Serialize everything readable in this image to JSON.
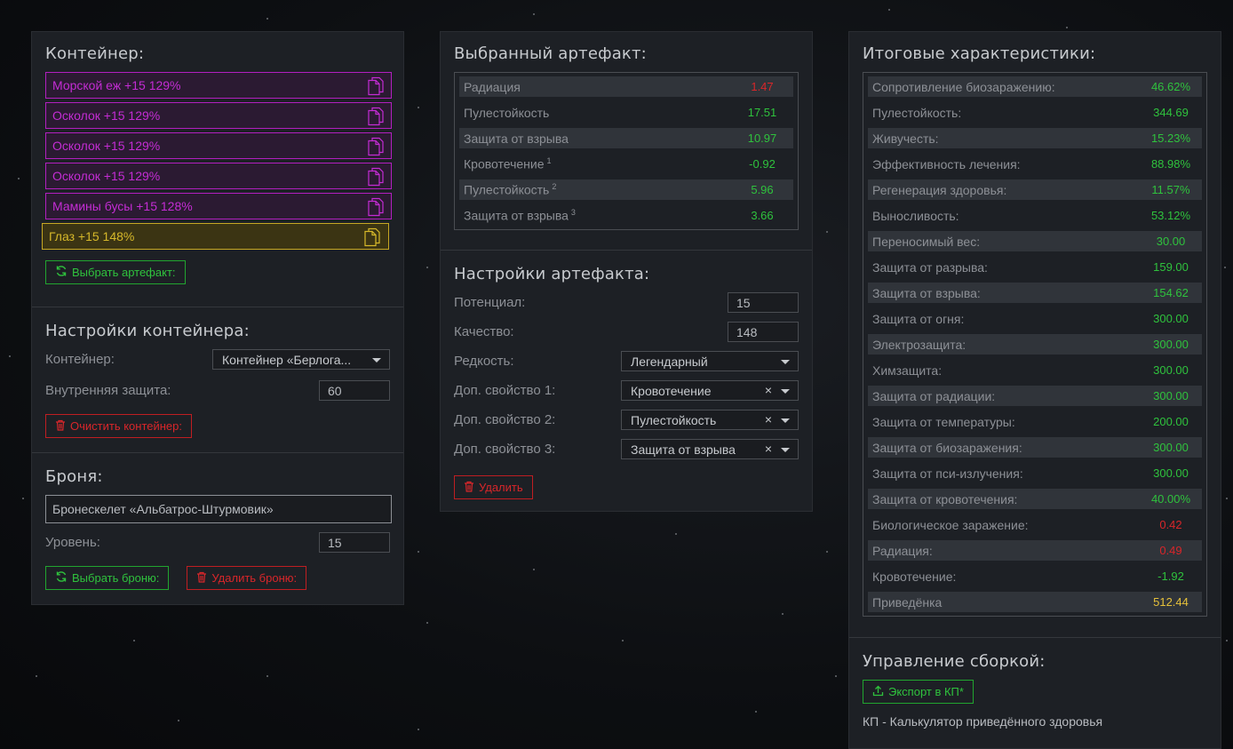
{
  "container_panel": {
    "title": "Контейнер:",
    "slots": [
      {
        "label": "Морской еж +15 129%",
        "color": "purple"
      },
      {
        "label": "Осколок +15 129%",
        "color": "purple"
      },
      {
        "label": "Осколок +15 129%",
        "color": "purple"
      },
      {
        "label": "Осколок +15 129%",
        "color": "purple"
      },
      {
        "label": "Мамины бусы +15 128%",
        "color": "purple"
      },
      {
        "label": "Глаз +15 148%",
        "color": "gold"
      }
    ],
    "select_artifact_button": "Выбрать артефакт:"
  },
  "container_settings": {
    "title": "Настройки контейнера:",
    "container_label": "Контейнер:",
    "container_value": "Контейнер «Берлога...",
    "inner_protection_label": "Внутренняя защита:",
    "inner_protection_value": "60",
    "clear_button": "Очистить контейнер:"
  },
  "armor": {
    "title": "Броня:",
    "armor_value": "Бронескелет «Альбатрос-Штурмовик»",
    "level_label": "Уровень:",
    "level_value": "15",
    "select_button": "Выбрать броню:",
    "delete_button": "Удалить броню:"
  },
  "selected_artifact": {
    "title": "Выбранный артефакт:",
    "stats": [
      {
        "name": "Радиация",
        "sup": "",
        "value": "1.47",
        "color": "red",
        "shade": true
      },
      {
        "name": "Пулестойкость",
        "sup": "",
        "value": "17.51",
        "color": "green",
        "shade": false
      },
      {
        "name": "Защита от взрыва",
        "sup": "",
        "value": "10.97",
        "color": "green",
        "shade": true
      },
      {
        "name": "Кровотечение",
        "sup": "1",
        "value": "-0.92",
        "color": "green",
        "shade": false
      },
      {
        "name": "Пулестойкость",
        "sup": "2",
        "value": "5.96",
        "color": "green",
        "shade": true
      },
      {
        "name": "Защита от взрыва",
        "sup": "3",
        "value": "3.66",
        "color": "green",
        "shade": false
      }
    ]
  },
  "artifact_settings": {
    "title": "Настройки артефакта:",
    "potential_label": "Потенциал:",
    "potential_value": "15",
    "quality_label": "Качество:",
    "quality_value": "148",
    "rarity_label": "Редкость:",
    "rarity_value": "Легендарный",
    "prop1_label": "Доп. свойство 1:",
    "prop1_value": "Кровотечение",
    "prop2_label": "Доп. свойство 2:",
    "prop2_value": "Пулестойкость",
    "prop3_label": "Доп. свойство 3:",
    "prop3_value": "Защита от взрыва",
    "clear_symbol": "×",
    "delete_button": "Удалить"
  },
  "totals": {
    "title": "Итоговые характеристики:",
    "stats": [
      {
        "name": "Сопротивление биозаражению:",
        "value": "46.62%",
        "color": "green",
        "shade": true
      },
      {
        "name": "Пулестойкость:",
        "value": "344.69",
        "color": "green",
        "shade": false
      },
      {
        "name": "Живучесть:",
        "value": "15.23%",
        "color": "green",
        "shade": true
      },
      {
        "name": "Эффективность лечения:",
        "value": "88.98%",
        "color": "green",
        "shade": false
      },
      {
        "name": "Регенерация здоровья:",
        "value": "11.57%",
        "color": "green",
        "shade": true
      },
      {
        "name": "Выносливость:",
        "value": "53.12%",
        "color": "green",
        "shade": false
      },
      {
        "name": "Переносимый вес:",
        "value": "30.00",
        "color": "green",
        "shade": true
      },
      {
        "name": "Защита от разрыва:",
        "value": "159.00",
        "color": "green",
        "shade": false
      },
      {
        "name": "Защита от взрыва:",
        "value": "154.62",
        "color": "green",
        "shade": true
      },
      {
        "name": "Защита от огня:",
        "value": "300.00",
        "color": "green",
        "shade": false
      },
      {
        "name": "Электрозащита:",
        "value": "300.00",
        "color": "green",
        "shade": true
      },
      {
        "name": "Химзащита:",
        "value": "300.00",
        "color": "green",
        "shade": false
      },
      {
        "name": "Защита от радиации:",
        "value": "300.00",
        "color": "green",
        "shade": true
      },
      {
        "name": "Защита от температуры:",
        "value": "200.00",
        "color": "green",
        "shade": false
      },
      {
        "name": "Защита от биозаражения:",
        "value": "300.00",
        "color": "green",
        "shade": true
      },
      {
        "name": "Защита от пси-излучения:",
        "value": "300.00",
        "color": "green",
        "shade": false
      },
      {
        "name": "Защита от кровотечения:",
        "value": "40.00%",
        "color": "green",
        "shade": true
      },
      {
        "name": "Биологическое заражение:",
        "value": "0.42",
        "color": "red",
        "shade": false
      },
      {
        "name": "Радиация:",
        "value": "0.49",
        "color": "red",
        "shade": true
      },
      {
        "name": "Кровотечение:",
        "value": "-1.92",
        "color": "green",
        "shade": false
      },
      {
        "name": "Приведёнка",
        "value": "512.44",
        "color": "gold",
        "shade": true
      }
    ]
  },
  "build_management": {
    "title": "Управление сборкой:",
    "export_button": "Экспорт в КП*",
    "footnote": "КП - Калькулятор приведённого здоровья"
  },
  "colors": {
    "purple": "#c42cd4",
    "gold": "#d6b82a",
    "green": "#2fc23d",
    "red": "#d8262a"
  }
}
